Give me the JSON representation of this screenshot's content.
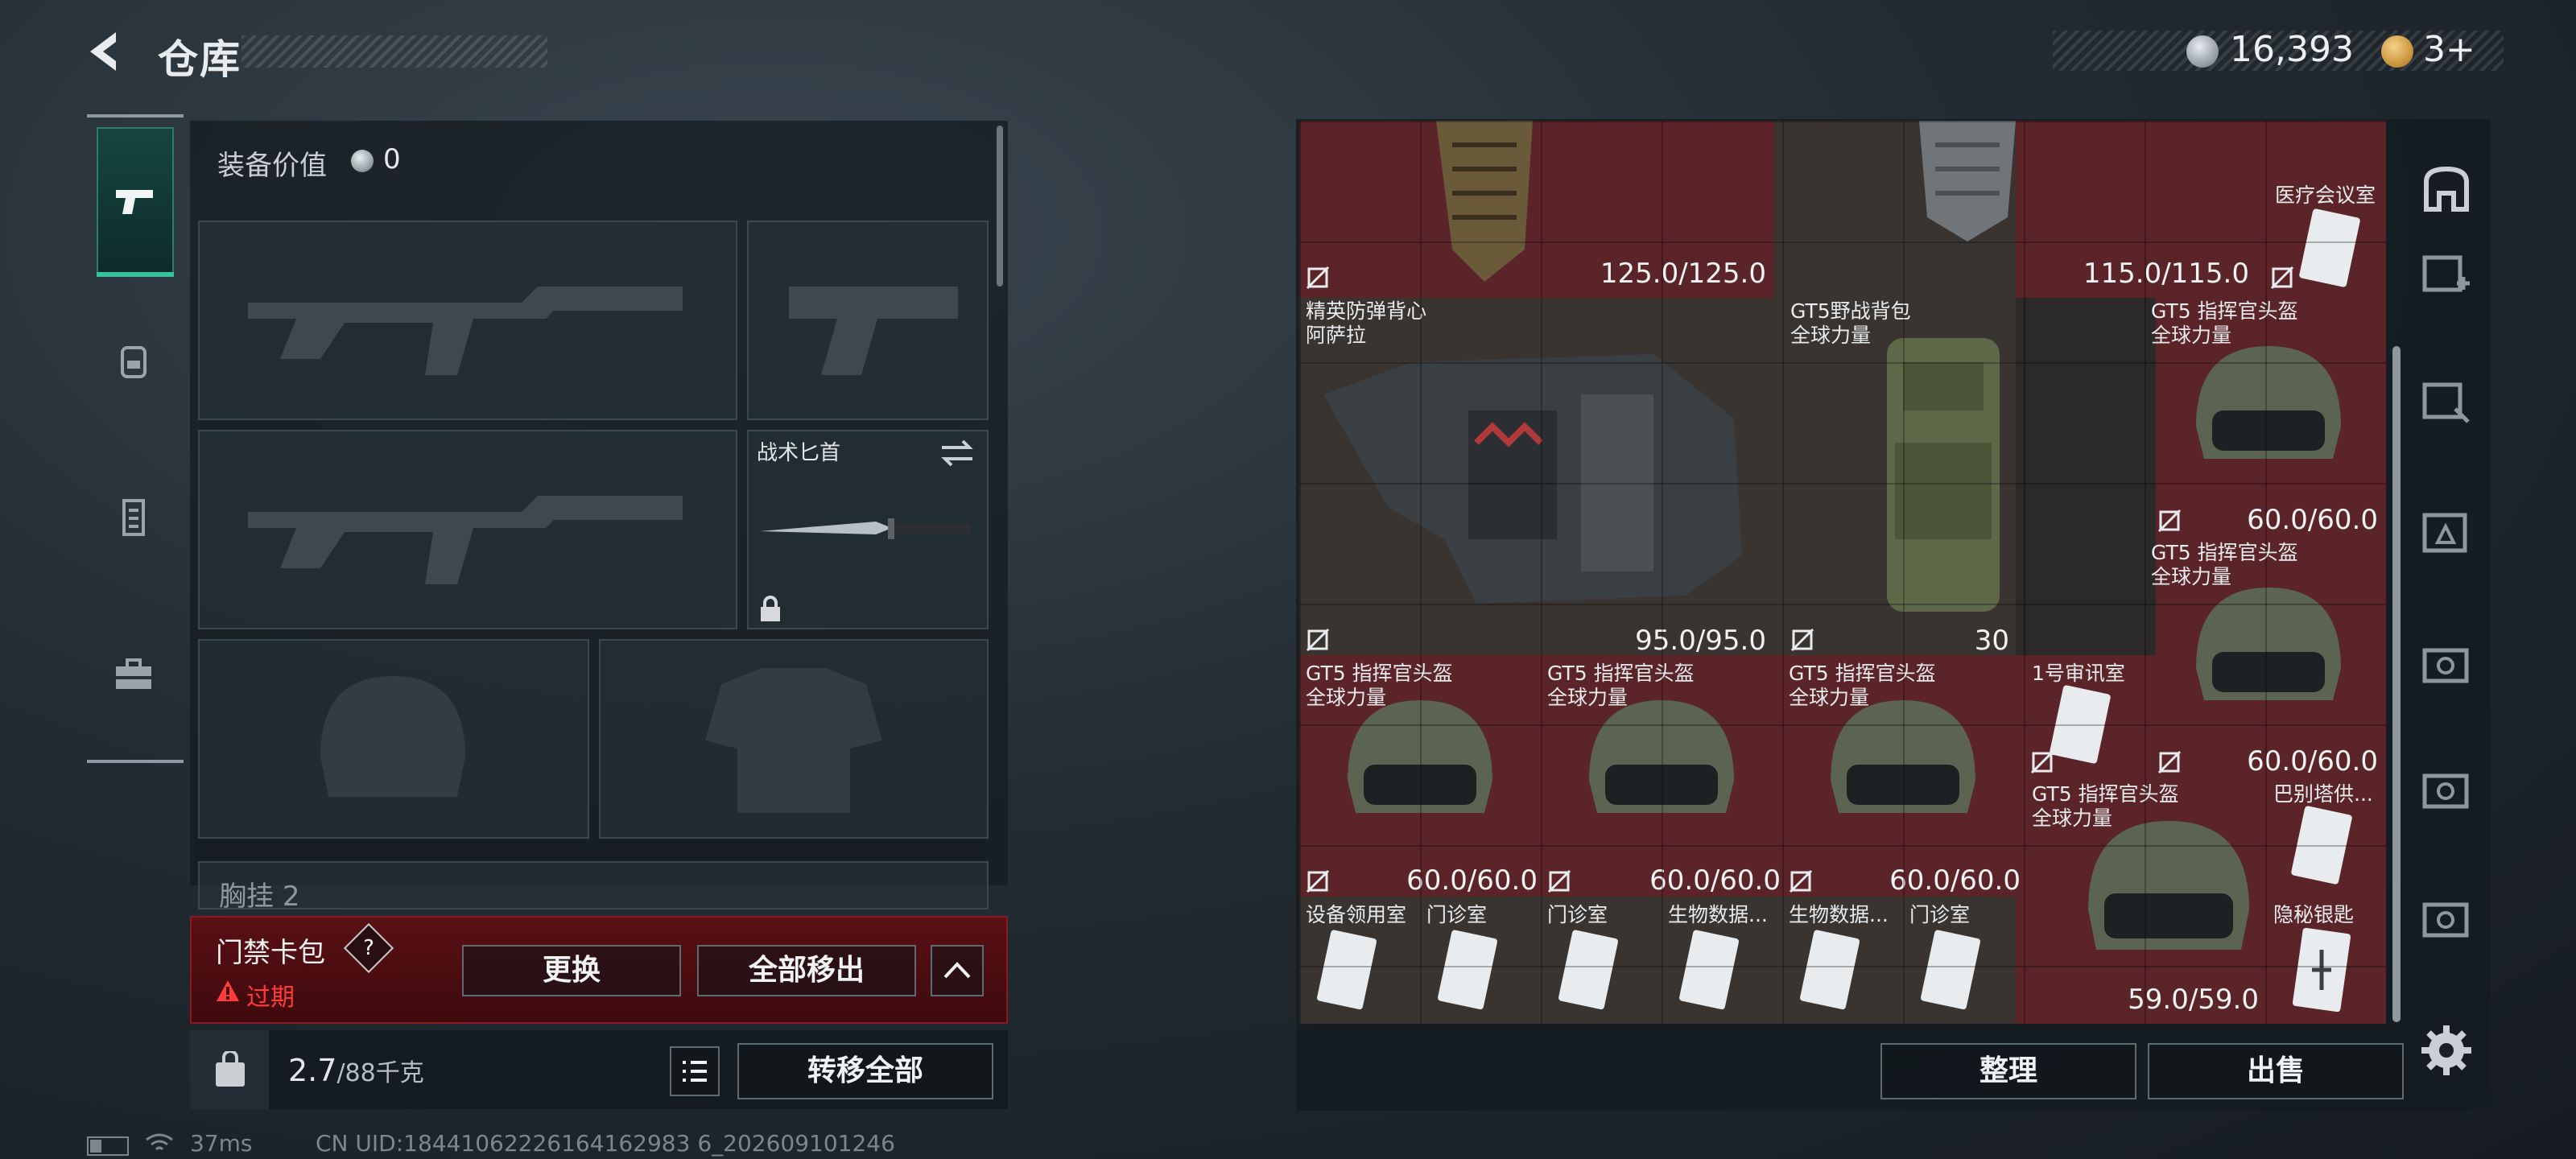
{
  "header": {
    "title": "仓库"
  },
  "currency": {
    "coins": "16,393",
    "tickets": "3+"
  },
  "equipment": {
    "value_label": "装备价值",
    "value": "0",
    "knife_label": "战术匕首",
    "chest_label": "胸挂",
    "chest_extra": "2"
  },
  "keycard": {
    "title": "门禁卡包",
    "help": "?",
    "status": "过期",
    "replace_label": "更换",
    "remove_all_label": "全部移出"
  },
  "weight": {
    "current": "2.7",
    "max": "/88千克"
  },
  "transfer_all_label": "转移全部",
  "stash": {
    "items": [
      {
        "id": "top-vest",
        "durability": "125.0/125.0"
      },
      {
        "id": "top-vest2",
        "durability": "115.0/115.0"
      },
      {
        "id": "medical-card",
        "name": "医疗会议室"
      },
      {
        "id": "armor",
        "name": "精英防弹背心",
        "sub": "阿萨拉",
        "durability": "95.0/95.0"
      },
      {
        "id": "backpack",
        "name": "GT5野战背包",
        "sub": "全球力量",
        "capacity": "30"
      },
      {
        "id": "helmet1",
        "name": "GT5 指挥官头盔",
        "sub": "全球力量",
        "durability": "60.0/60.0"
      },
      {
        "id": "helmet2",
        "name": "GT5 指挥官头盔",
        "sub": "全球力量",
        "durability": "60.0/60.0"
      },
      {
        "id": "helmet3",
        "name": "GT5 指挥官头盔",
        "sub": "全球力量",
        "durability": "60.0/60.0"
      },
      {
        "id": "helmet4",
        "name": "GT5 指挥官头盔",
        "sub": "全球力量",
        "durability": "60.0/60.0"
      },
      {
        "id": "helmet5",
        "name": "GT5 指挥官头盔",
        "sub": "全球力量",
        "durability": "60.0/60.0"
      },
      {
        "id": "card-comm",
        "name": "1号审讯室"
      },
      {
        "id": "helmet6",
        "name": "GT5 指挥官头盔",
        "sub": "全球力量",
        "durability": "59.0/59.0"
      },
      {
        "id": "card-babel",
        "name": "巴别塔供..."
      },
      {
        "id": "card-secret",
        "name": "隐秘银匙"
      },
      {
        "id": "card-a",
        "name": "设备领用室"
      },
      {
        "id": "card-b",
        "name": "门诊室"
      },
      {
        "id": "card-c",
        "name": "门诊室"
      },
      {
        "id": "card-d",
        "name": "生物数据..."
      },
      {
        "id": "card-e",
        "name": "生物数据..."
      },
      {
        "id": "card-f",
        "name": "门诊室"
      }
    ]
  },
  "actions": {
    "tidy": "整理",
    "sell": "出售"
  },
  "status_bar": {
    "ping": "37ms",
    "uid": "CN UID:18441062226164162983 6_202609101246"
  },
  "colors": {
    "accent": "#35c19c",
    "warning": "#ff3b3b",
    "slot_red": "#5b2428"
  },
  "icons": [
    "back-arrow-icon",
    "coin-icon",
    "ticket-icon",
    "pistol-icon",
    "backpack-icon",
    "vest-icon",
    "toolbox-icon",
    "lock-icon",
    "swap-icon",
    "warning-icon",
    "list-icon",
    "weight-icon",
    "gear-icon",
    "no-insure-icon",
    "helmet-icon"
  ]
}
